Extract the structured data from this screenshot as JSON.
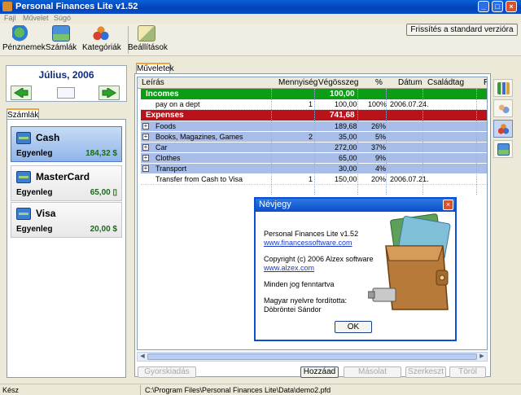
{
  "window": {
    "title": "Personal Finances Lite v1.52"
  },
  "menu": {
    "items": [
      "Fájl",
      "Művelet",
      "Súgó"
    ]
  },
  "toolbar": {
    "buttons": [
      {
        "label": "Pénznemek",
        "icon": "currency-icon"
      },
      {
        "label": "Számlák",
        "icon": "accounts-icon"
      },
      {
        "label": "Kategóriák",
        "icon": "categories-icon"
      },
      {
        "label": "Beállítások",
        "icon": "settings-icon"
      }
    ],
    "refresh_label": "Frissítés a standard verzióra"
  },
  "date_nav": {
    "label": "Július, 2006"
  },
  "accounts": {
    "tab_label": "Számlák",
    "items": [
      {
        "name": "Cash",
        "balance_label": "Egyenleg",
        "balance": "184,32 $"
      },
      {
        "name": "MasterCard",
        "balance_label": "Egyenleg",
        "balance": "65,00 ▯"
      },
      {
        "name": "Visa",
        "balance_label": "Egyenleg",
        "balance": "20,00 $"
      }
    ]
  },
  "operations": {
    "tab_label": "Műveletek",
    "columns": [
      "Leírás",
      "Mennyiség",
      "Végösszeg",
      "%",
      "Dátum",
      "Családtag",
      "R"
    ],
    "rows": [
      {
        "kind": "group-income",
        "desc": "Incomes",
        "qty": "",
        "total": "100,00",
        "pct": "",
        "date": ""
      },
      {
        "kind": "detail",
        "desc": "pay on a dept",
        "qty": "1",
        "total": "100,00",
        "pct": "100%",
        "date": "2006.07.24."
      },
      {
        "kind": "group-expense",
        "desc": "Expenses",
        "qty": "",
        "total": "741,68",
        "pct": "",
        "date": ""
      },
      {
        "kind": "cat",
        "desc": "Foods",
        "qty": "",
        "total": "189,68",
        "pct": "26%",
        "date": ""
      },
      {
        "kind": "cat",
        "desc": "Books, Magazines, Games",
        "qty": "2",
        "total": "35,00",
        "pct": "5%",
        "date": ""
      },
      {
        "kind": "cat",
        "desc": "Car",
        "qty": "",
        "total": "272,00",
        "pct": "37%",
        "date": ""
      },
      {
        "kind": "cat",
        "desc": "Clothes",
        "qty": "",
        "total": "65,00",
        "pct": "9%",
        "date": ""
      },
      {
        "kind": "cat",
        "desc": "Transport",
        "qty": "",
        "total": "30,00",
        "pct": "4%",
        "date": ""
      },
      {
        "kind": "detail",
        "desc": "Transfer from Cash to Visa",
        "qty": "1",
        "total": "150,00",
        "pct": "20%",
        "date": "2006.07.21."
      }
    ],
    "buttons": {
      "quick": "Gyorskiadás",
      "add": "Hozzáad",
      "copy": "Másolat",
      "edit": "Szerkeszt",
      "delete": "Töröl"
    }
  },
  "about_dialog": {
    "title": "Névjegy",
    "product": "Personal Finances Lite v1.52",
    "product_url": "www.financessoftware.com",
    "copyright": "Copyright (c) 2006 Alzex software",
    "company_url": "www.alzex.com",
    "rights": "Minden jog fenntartva",
    "translator_line1": "Magyar nyelvre fordította:",
    "translator_line2": "Döbröntei Sándor",
    "ok_label": "OK"
  },
  "status": {
    "state": "Kész",
    "file_path": "C:\\Program Files\\Personal Finances Lite\\Data\\demo2.pfd"
  },
  "colors": {
    "income": "#0b9d14",
    "expense": "#b8131b",
    "category": "#a8bde8",
    "titlebar": "#0342b6"
  }
}
